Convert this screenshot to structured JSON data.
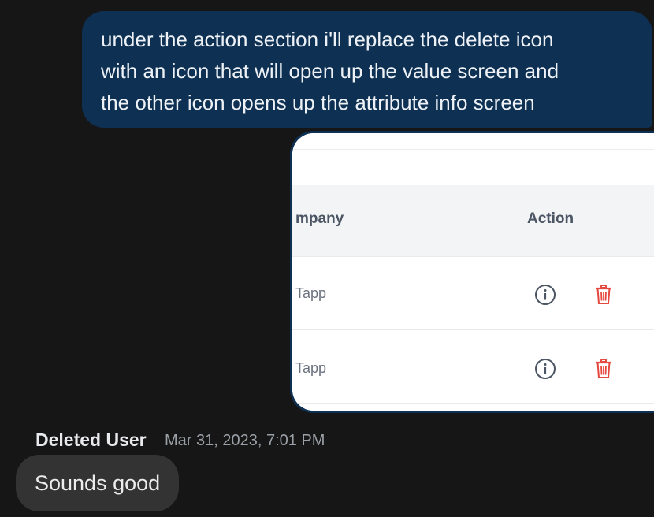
{
  "messages": {
    "outgoing": {
      "text": "under the action section i'll replace the delete icon\nwith an icon that will open up the value screen and\nthe other icon opens up the attribute info screen"
    },
    "attachment": {
      "table": {
        "headers": {
          "company": "mpany",
          "action": "Action"
        },
        "rows": [
          {
            "company": "Tapp",
            "actions": [
              "info-icon",
              "trash-icon"
            ]
          },
          {
            "company": "Tapp",
            "actions": [
              "info-icon",
              "trash-icon"
            ]
          }
        ]
      },
      "colors": {
        "header_bg": "#f3f4f6",
        "delete_icon": "#e5483f",
        "info_icon": "#4b5563"
      }
    },
    "incoming": {
      "sender": "Deleted User",
      "timestamp": "Mar 31, 2023, 7:01 PM",
      "text": "Sounds good"
    }
  },
  "colors": {
    "background": "#161616",
    "outgoing_bubble": "#0e3052",
    "incoming_bubble": "#333333"
  }
}
